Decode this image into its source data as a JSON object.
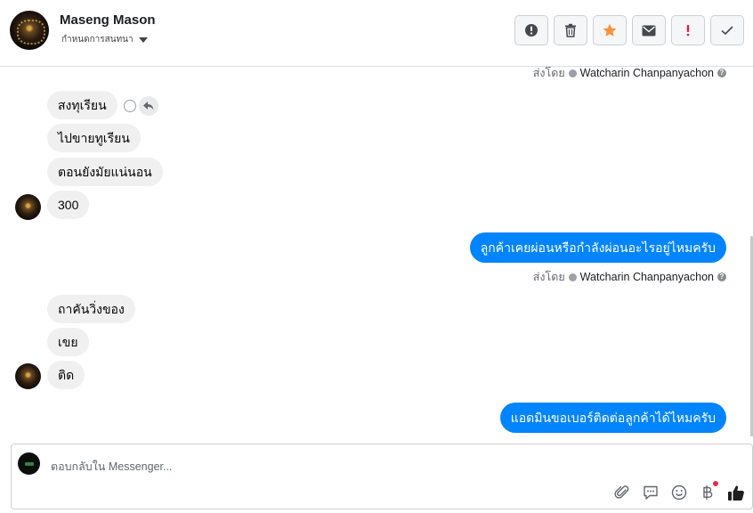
{
  "header": {
    "contact_name": "Maseng Mason",
    "subtitle": "กำหนดการสนทนา",
    "actions": [
      "mark-spam",
      "delete",
      "star",
      "email",
      "important",
      "done"
    ]
  },
  "thread": {
    "sent_by_prefix": "ส่งโดย",
    "sent_by_name": "Watcharin Chanpanyachon",
    "messages": [
      {
        "from": "customer",
        "text": "สงทุเรียน"
      },
      {
        "from": "customer",
        "text": "ไปขายทูเรียน"
      },
      {
        "from": "customer",
        "text": "ตอนยังมัยแน่นอน"
      },
      {
        "from": "customer",
        "text": "300"
      },
      {
        "from": "page",
        "text": "ลูกค้าเคยผ่อนหรือกำลังผ่อนอะไรอยู่ไหมครับ"
      },
      {
        "from": "customer",
        "text": "ถาคันวิ่งของ"
      },
      {
        "from": "customer",
        "text": "เขย"
      },
      {
        "from": "customer",
        "text": "ติด"
      },
      {
        "from": "page",
        "text": "แอดมินขอเบอร์ติดต่อลูกค้าได้ไหมครับ"
      }
    ]
  },
  "composer": {
    "placeholder": "ตอบกลับใน Messenger...",
    "tools": [
      "attach-icon",
      "saved-reply-icon",
      "emoji-icon",
      "payment-icon",
      "like-icon"
    ]
  },
  "colors": {
    "outgoing": "#0084ff",
    "incoming": "#f0f0f0",
    "star": "#f7923a",
    "important": "#e41e3f"
  }
}
